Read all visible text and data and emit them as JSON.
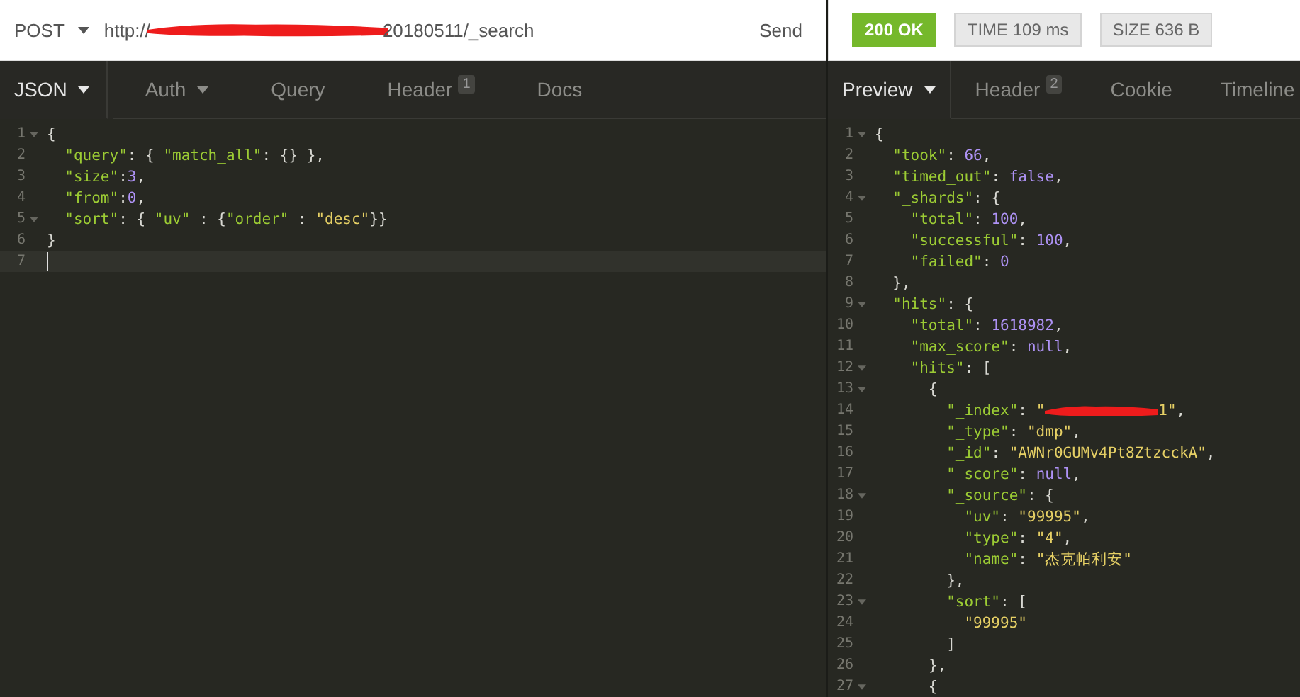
{
  "request": {
    "method": "POST",
    "url_start": "http://",
    "url_end": "20180511/_search",
    "send": "Send",
    "tabs": [
      {
        "label": "JSON",
        "selected": true,
        "dropdown": true
      },
      {
        "label": "Auth",
        "selected": false,
        "dropdown": true
      },
      {
        "label": "Query",
        "selected": false,
        "dropdown": false
      },
      {
        "label": "Header",
        "selected": false,
        "dropdown": false,
        "badge": "1"
      },
      {
        "label": "Docs",
        "selected": false,
        "dropdown": false
      }
    ],
    "lines": [
      {
        "no": "1",
        "fold": true,
        "current": false,
        "tokens": [
          {
            "kind": "p",
            "text": "{"
          }
        ]
      },
      {
        "no": "2",
        "fold": false,
        "current": false,
        "tokens": [
          {
            "kind": "key",
            "text": "  \"query\""
          },
          {
            "kind": "p",
            "text": ": { "
          },
          {
            "kind": "key",
            "text": "\"match_all\""
          },
          {
            "kind": "p",
            "text": ": {} },"
          }
        ]
      },
      {
        "no": "3",
        "fold": false,
        "current": false,
        "tokens": [
          {
            "kind": "key",
            "text": "  \"size\""
          },
          {
            "kind": "p",
            "text": ":"
          },
          {
            "kind": "num",
            "text": "3"
          },
          {
            "kind": "p",
            "text": ","
          }
        ]
      },
      {
        "no": "4",
        "fold": false,
        "current": false,
        "tokens": [
          {
            "kind": "key",
            "text": "  \"from\""
          },
          {
            "kind": "p",
            "text": ":"
          },
          {
            "kind": "num",
            "text": "0"
          },
          {
            "kind": "p",
            "text": ","
          }
        ]
      },
      {
        "no": "5",
        "fold": true,
        "current": false,
        "tokens": [
          {
            "kind": "key",
            "text": "  \"sort\""
          },
          {
            "kind": "p",
            "text": ": { "
          },
          {
            "kind": "key",
            "text": "\"uv\""
          },
          {
            "kind": "p",
            "text": " : {"
          },
          {
            "kind": "key",
            "text": "\"order\""
          },
          {
            "kind": "p",
            "text": " : "
          },
          {
            "kind": "str",
            "text": "\"desc\""
          },
          {
            "kind": "p",
            "text": "}}"
          }
        ]
      },
      {
        "no": "6",
        "fold": false,
        "current": false,
        "tokens": [
          {
            "kind": "p",
            "text": "}"
          }
        ]
      },
      {
        "no": "7",
        "fold": false,
        "current": true
      }
    ]
  },
  "response": {
    "status": "200 OK",
    "time": "TIME 109 ms",
    "size": "SIZE 636 B",
    "tabs": [
      {
        "label": "Preview",
        "selected": true,
        "dropdown": true
      },
      {
        "label": "Header",
        "selected": false,
        "dropdown": false,
        "badge": "2"
      },
      {
        "label": "Cookie",
        "selected": false,
        "dropdown": false
      },
      {
        "label": "Timeline",
        "selected": false,
        "dropdown": false
      }
    ],
    "lines": [
      {
        "no": "1",
        "fold": true,
        "tokens": [
          {
            "kind": "p",
            "text": "{"
          }
        ]
      },
      {
        "no": "2",
        "fold": false,
        "tokens": [
          {
            "kind": "key",
            "text": "  \"took\""
          },
          {
            "kind": "p",
            "text": ": "
          },
          {
            "kind": "num",
            "text": "66"
          },
          {
            "kind": "p",
            "text": ","
          }
        ]
      },
      {
        "no": "3",
        "fold": false,
        "tokens": [
          {
            "kind": "key",
            "text": "  \"timed_out\""
          },
          {
            "kind": "p",
            "text": ": "
          },
          {
            "kind": "num",
            "text": "false"
          },
          {
            "kind": "p",
            "text": ","
          }
        ]
      },
      {
        "no": "4",
        "fold": true,
        "tokens": [
          {
            "kind": "key",
            "text": "  \"_shards\""
          },
          {
            "kind": "p",
            "text": ": {"
          }
        ]
      },
      {
        "no": "5",
        "fold": false,
        "tokens": [
          {
            "kind": "key",
            "text": "    \"total\""
          },
          {
            "kind": "p",
            "text": ": "
          },
          {
            "kind": "num",
            "text": "100"
          },
          {
            "kind": "p",
            "text": ","
          }
        ]
      },
      {
        "no": "6",
        "fold": false,
        "tokens": [
          {
            "kind": "key",
            "text": "    \"successful\""
          },
          {
            "kind": "p",
            "text": ": "
          },
          {
            "kind": "num",
            "text": "100"
          },
          {
            "kind": "p",
            "text": ","
          }
        ]
      },
      {
        "no": "7",
        "fold": false,
        "tokens": [
          {
            "kind": "key",
            "text": "    \"failed\""
          },
          {
            "kind": "p",
            "text": ": "
          },
          {
            "kind": "num",
            "text": "0"
          }
        ]
      },
      {
        "no": "8",
        "fold": false,
        "tokens": [
          {
            "kind": "p",
            "text": "  },"
          }
        ]
      },
      {
        "no": "9",
        "fold": true,
        "tokens": [
          {
            "kind": "key",
            "text": "  \"hits\""
          },
          {
            "kind": "p",
            "text": ": {"
          }
        ]
      },
      {
        "no": "10",
        "fold": false,
        "tokens": [
          {
            "kind": "key",
            "text": "    \"total\""
          },
          {
            "kind": "p",
            "text": ": "
          },
          {
            "kind": "num",
            "text": "1618982"
          },
          {
            "kind": "p",
            "text": ","
          }
        ]
      },
      {
        "no": "11",
        "fold": false,
        "tokens": [
          {
            "kind": "key",
            "text": "    \"max_score\""
          },
          {
            "kind": "p",
            "text": ": "
          },
          {
            "kind": "num",
            "text": "null"
          },
          {
            "kind": "p",
            "text": ","
          }
        ]
      },
      {
        "no": "12",
        "fold": true,
        "tokens": [
          {
            "kind": "key",
            "text": "    \"hits\""
          },
          {
            "kind": "p",
            "text": ": ["
          }
        ]
      },
      {
        "no": "13",
        "fold": true,
        "tokens": [
          {
            "kind": "p",
            "text": "      {"
          }
        ]
      },
      {
        "no": "14",
        "fold": false,
        "tokens": [
          {
            "kind": "key",
            "text": "        \"_index\""
          },
          {
            "kind": "p",
            "text": ": "
          },
          {
            "kind": "str",
            "text": "\""
          },
          {
            "kind": "redacted"
          },
          {
            "kind": "str",
            "text": "1\""
          },
          {
            "kind": "p",
            "text": ","
          }
        ]
      },
      {
        "no": "15",
        "fold": false,
        "tokens": [
          {
            "kind": "key",
            "text": "        \"_type\""
          },
          {
            "kind": "p",
            "text": ": "
          },
          {
            "kind": "str",
            "text": "\"dmp\""
          },
          {
            "kind": "p",
            "text": ","
          }
        ]
      },
      {
        "no": "16",
        "fold": false,
        "tokens": [
          {
            "kind": "key",
            "text": "        \"_id\""
          },
          {
            "kind": "p",
            "text": ": "
          },
          {
            "kind": "str",
            "text": "\"AWNr0GUMv4Pt8ZtzcckA\""
          },
          {
            "kind": "p",
            "text": ","
          }
        ]
      },
      {
        "no": "17",
        "fold": false,
        "tokens": [
          {
            "kind": "key",
            "text": "        \"_score\""
          },
          {
            "kind": "p",
            "text": ": "
          },
          {
            "kind": "num",
            "text": "null"
          },
          {
            "kind": "p",
            "text": ","
          }
        ]
      },
      {
        "no": "18",
        "fold": true,
        "tokens": [
          {
            "kind": "key",
            "text": "        \"_source\""
          },
          {
            "kind": "p",
            "text": ": {"
          }
        ]
      },
      {
        "no": "19",
        "fold": false,
        "tokens": [
          {
            "kind": "key",
            "text": "          \"uv\""
          },
          {
            "kind": "p",
            "text": ": "
          },
          {
            "kind": "str",
            "text": "\"99995\""
          },
          {
            "kind": "p",
            "text": ","
          }
        ]
      },
      {
        "no": "20",
        "fold": false,
        "tokens": [
          {
            "kind": "key",
            "text": "          \"type\""
          },
          {
            "kind": "p",
            "text": ": "
          },
          {
            "kind": "str",
            "text": "\"4\""
          },
          {
            "kind": "p",
            "text": ","
          }
        ]
      },
      {
        "no": "21",
        "fold": false,
        "tokens": [
          {
            "kind": "key",
            "text": "          \"name\""
          },
          {
            "kind": "p",
            "text": ": "
          },
          {
            "kind": "str",
            "text": "\"杰克帕利安\""
          }
        ]
      },
      {
        "no": "22",
        "fold": false,
        "tokens": [
          {
            "kind": "p",
            "text": "        },"
          }
        ]
      },
      {
        "no": "23",
        "fold": true,
        "tokens": [
          {
            "kind": "key",
            "text": "        \"sort\""
          },
          {
            "kind": "p",
            "text": ": ["
          }
        ]
      },
      {
        "no": "24",
        "fold": false,
        "tokens": [
          {
            "kind": "str",
            "text": "          \"99995\""
          }
        ]
      },
      {
        "no": "25",
        "fold": false,
        "tokens": [
          {
            "kind": "p",
            "text": "        ]"
          }
        ]
      },
      {
        "no": "26",
        "fold": false,
        "tokens": [
          {
            "kind": "p",
            "text": "      },"
          }
        ]
      },
      {
        "no": "27",
        "fold": true,
        "tokens": [
          {
            "kind": "p",
            "text": "      {"
          }
        ]
      }
    ]
  }
}
